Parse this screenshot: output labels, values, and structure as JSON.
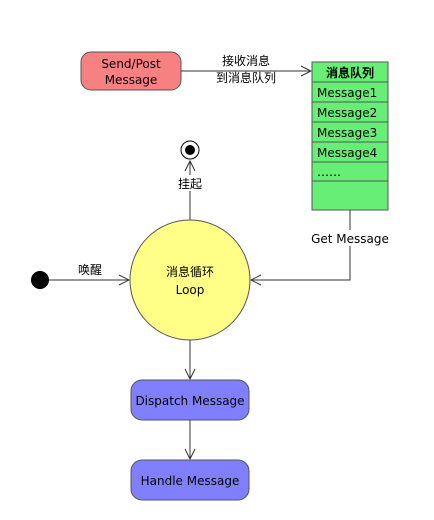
{
  "nodes": {
    "send_post": {
      "label_line1": "Send/Post",
      "label_line2": "Message",
      "fill": "#f78080"
    },
    "queue": {
      "title": "消息队列",
      "items": [
        "Message1",
        "Message2",
        "Message3",
        "Message4",
        "……"
      ],
      "fill": "#66ee77"
    },
    "loop": {
      "label_line1": "消息循环",
      "label_line2": "Loop",
      "fill": "#ffff88"
    },
    "dispatch": {
      "label": "Dispatch Message",
      "fill": "#8080ff"
    },
    "handle": {
      "label": "Handle Message",
      "fill": "#8080ff"
    }
  },
  "edges": {
    "receive_label_line1": "接收消息",
    "receive_label_line2": "到消息队列",
    "get_message_label": "Get Message",
    "wake_label": "唤醒",
    "suspend_label": "挂起"
  },
  "colors": {
    "line": "#333333",
    "stroke": "#555555"
  }
}
